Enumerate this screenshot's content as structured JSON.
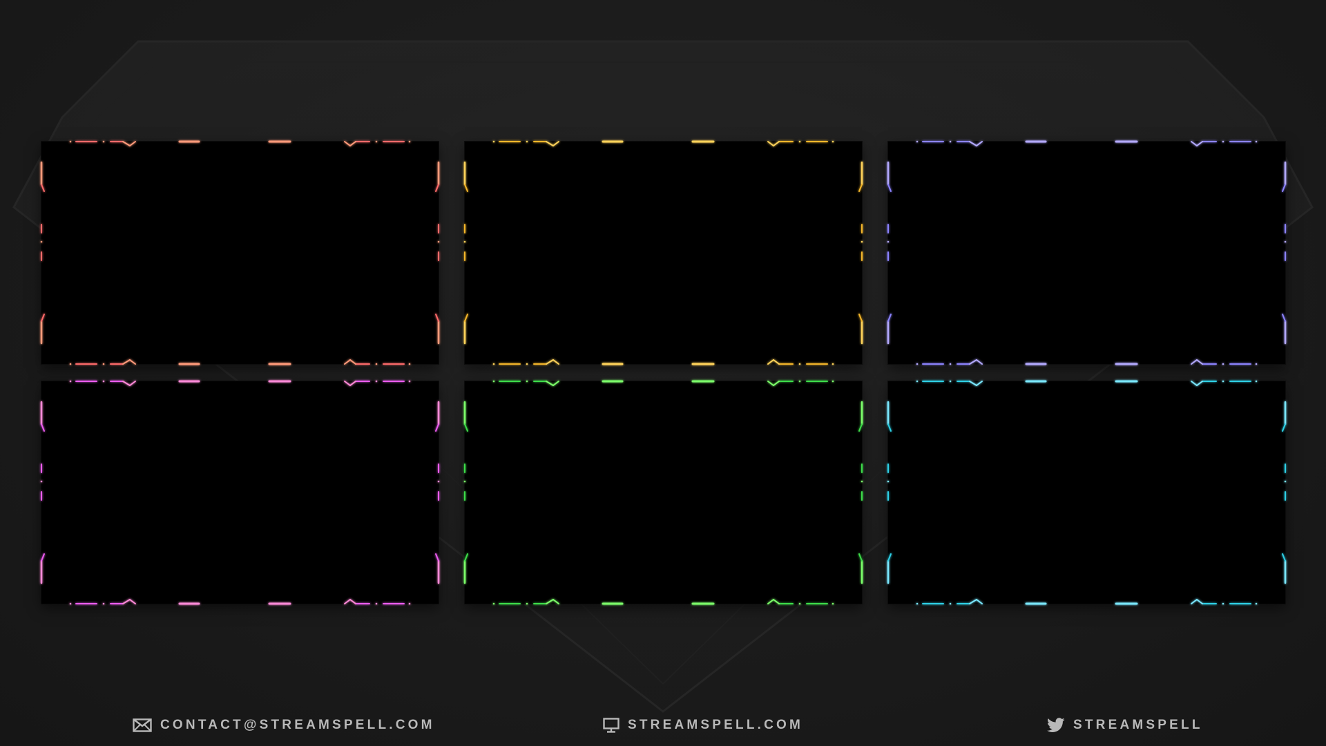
{
  "panels": [
    {
      "id": "red",
      "accent": "#ff6b6b",
      "accent2": "#ff9a7a"
    },
    {
      "id": "gold",
      "accent": "#f4b62a",
      "accent2": "#ffd35a"
    },
    {
      "id": "violet",
      "accent": "#8c83ff",
      "accent2": "#b3a9ff"
    },
    {
      "id": "pink",
      "accent": "#ec5cf0",
      "accent2": "#ff8ad8"
    },
    {
      "id": "green",
      "accent": "#3ddc4a",
      "accent2": "#7cff6a"
    },
    {
      "id": "cyan",
      "accent": "#2fd0e6",
      "accent2": "#7ae8ff"
    }
  ],
  "footer": {
    "email": {
      "icon": "envelope-icon",
      "label": "CONTACT@STREAMSPELL.COM"
    },
    "website": {
      "icon": "monitor-icon",
      "label": "STREAMSPELL.COM"
    },
    "twitter": {
      "icon": "twitter-bird-icon",
      "label": "STREAMSPELL"
    }
  },
  "colors": {
    "background": "#1a1a1a",
    "panel": "#000000",
    "footer_text": "#b9b9b9"
  }
}
